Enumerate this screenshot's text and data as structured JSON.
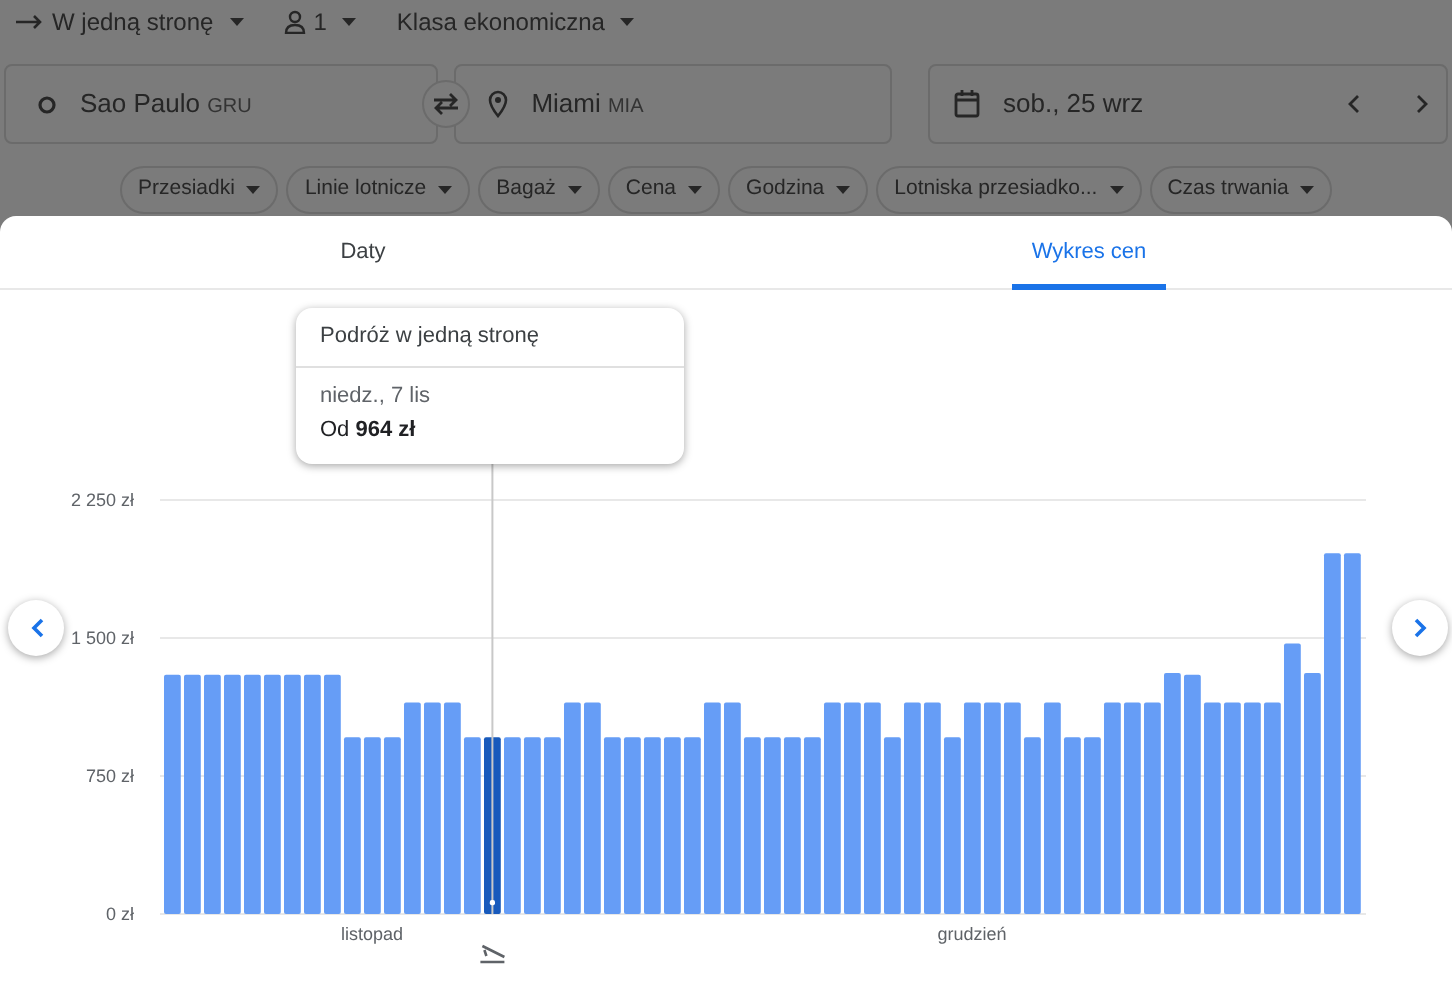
{
  "search_bar": {
    "trip_type": "W jedną stronę",
    "passengers": "1",
    "cabin_class": "Klasa ekonomiczna"
  },
  "origin": {
    "city": "Sao Paulo",
    "code": "GRU"
  },
  "destination": {
    "city": "Miami",
    "code": "MIA"
  },
  "date": {
    "value": "sob., 25 wrz"
  },
  "filters": [
    "Przesiadki",
    "Linie lotnicze",
    "Bagaż",
    "Cena",
    "Godzina",
    "Lotniska przesiadko...",
    "Czas trwania"
  ],
  "tabs": [
    {
      "label": "Daty",
      "selected": false
    },
    {
      "label": "Wykres cen",
      "selected": true
    }
  ],
  "tooltip": {
    "title": "Podróż w jedną stronę",
    "date": "niedz., 7 lis",
    "price": "Od **964 zł**"
  },
  "month_labels": [
    "listopad",
    "grudzień"
  ],
  "chart_data": {
    "type": "bar",
    "ylim": [
      0,
      2250
    ],
    "grid": true,
    "yticks": [
      {
        "value": 0,
        "label": "0 zł"
      },
      {
        "value": 750,
        "label": "750 zł"
      },
      {
        "value": 1500,
        "label": "1 500 zł"
      },
      {
        "value": 2250,
        "label": "2 250 zł"
      }
    ],
    "series": [
      {
        "color": "#669df6",
        "values": [
          1300,
          1300,
          1300,
          1300,
          1300,
          1300,
          1300,
          1300,
          1300,
          960,
          960,
          960,
          1150,
          1150,
          1150,
          960,
          null,
          960,
          960,
          960,
          1150,
          1150,
          960,
          960,
          960,
          960,
          960,
          1150,
          1150,
          960,
          960,
          960,
          960,
          1150,
          1150,
          1150,
          960,
          1150,
          1150,
          960,
          1150,
          1150,
          1150,
          960,
          1150,
          960,
          960,
          1150,
          1150,
          1150,
          1310,
          1300,
          1150,
          1150,
          1150,
          1150,
          1470,
          1310,
          1960,
          1960
        ]
      },
      {
        "color": "#185abc",
        "values": [
          null,
          null,
          null,
          null,
          null,
          null,
          null,
          null,
          null,
          null,
          null,
          null,
          null,
          null,
          null,
          null,
          960,
          null,
          null,
          null,
          null,
          null,
          null,
          null,
          null,
          null,
          null,
          null,
          null,
          null,
          null,
          null,
          null,
          null,
          null,
          null,
          null,
          null,
          null,
          null,
          null,
          null,
          null,
          null,
          null,
          null,
          null,
          null,
          null,
          null,
          null,
          null,
          null,
          null,
          null,
          null,
          null,
          null,
          null,
          null
        ]
      }
    ]
  }
}
